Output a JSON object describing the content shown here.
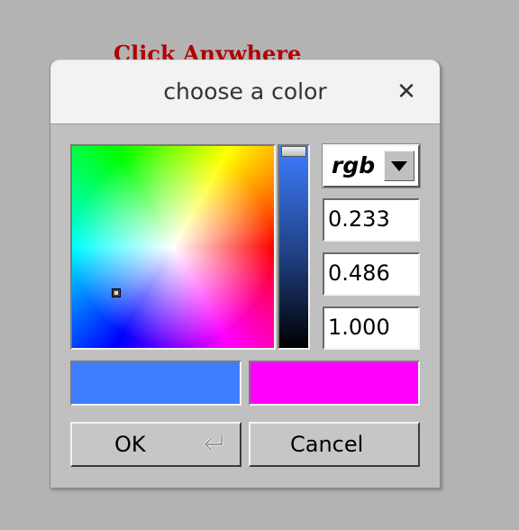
{
  "background": {
    "text": "Click Anywhere"
  },
  "dialog": {
    "title": "choose a color",
    "close_glyph": "✕",
    "mode": "rgb",
    "fields": [
      "0.233",
      "0.486",
      "1.000"
    ],
    "current_color": "#3d7dff",
    "previous_color": "#ff00ff",
    "ok_label": "OK",
    "cancel_label": "Cancel",
    "ok_icon": "enter-key-icon"
  }
}
